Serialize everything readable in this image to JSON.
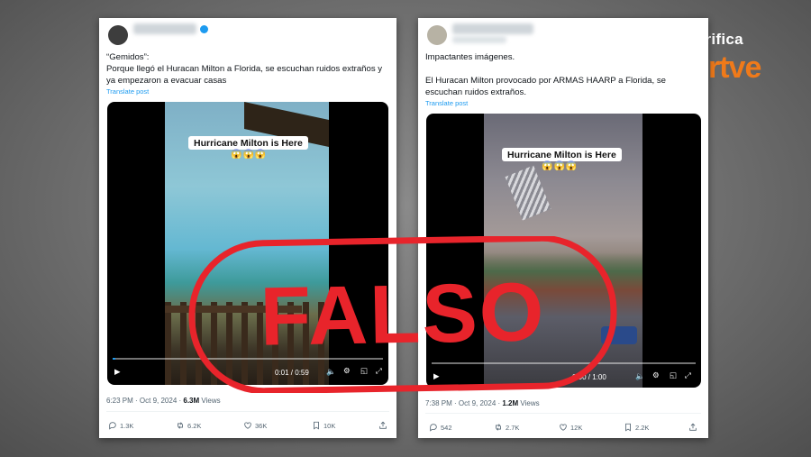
{
  "brand": {
    "verifica": "Verifica",
    "rtve": "rtve"
  },
  "stamp": {
    "label": "FALSO",
    "color": "#e8242b"
  },
  "posts": [
    {
      "text_line1": "“Gemidos”:",
      "text_line2": "Porque llegó el Huracan Milton a Florida, se escuchan ruidos extraños y ya empezaron a evacuar casas",
      "translate": "Translate post",
      "video": {
        "caption": "Hurricane Milton is Here",
        "emoji": "😱😱😱",
        "time": "0:01 / 0:59"
      },
      "timestamp": "6:23 PM · Oct 9, 2024 · ",
      "views": "6.3M",
      "views_label": " Views",
      "stats": {
        "replies": "1.3K",
        "reposts": "6.2K",
        "likes": "36K",
        "bookmarks": "10K"
      }
    },
    {
      "text_line1": "Impactantes imágenes.",
      "text_line2": "El Huracan Milton provocado por ARMAS HAARP a Florida, se escuchan ruidos extraños.",
      "translate": "Translate post",
      "video": {
        "caption": "Hurricane Milton is Here",
        "emoji": "😱😱😱",
        "time": "0:00 / 1:00"
      },
      "timestamp": "7:38 PM · Oct 9, 2024 · ",
      "views": "1.2M",
      "views_label": " Views",
      "stats": {
        "replies": "542",
        "reposts": "2.7K",
        "likes": "12K",
        "bookmarks": "2.2K"
      }
    }
  ],
  "icons": {
    "reply": "reply-icon",
    "repost": "repost-icon",
    "like": "heart-icon",
    "bookmark": "bookmark-icon",
    "share": "share-icon",
    "play": "play-icon",
    "settings": "gear-icon",
    "volume": "volume-icon",
    "fullscreen": "fullscreen-icon"
  }
}
